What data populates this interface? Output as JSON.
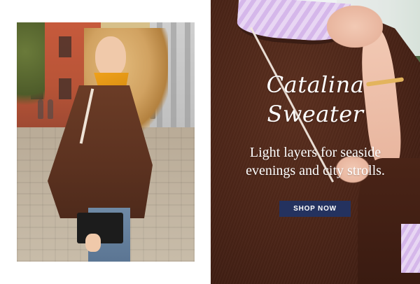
{
  "hero": {
    "title_line1": "Catalina",
    "title_line2": "Sweater",
    "subtitle_line1": "Light layers for seaside",
    "subtitle_line2": "evenings and city strolls.",
    "cta_label": "SHOP NOW"
  },
  "colors": {
    "cta_background": "#24325f",
    "headline_text": "#ffffff",
    "sweater_brown": "#4a2417"
  },
  "images": {
    "left_photo": "model-street-photo",
    "right_photo": "sweater-closeup-photo"
  }
}
